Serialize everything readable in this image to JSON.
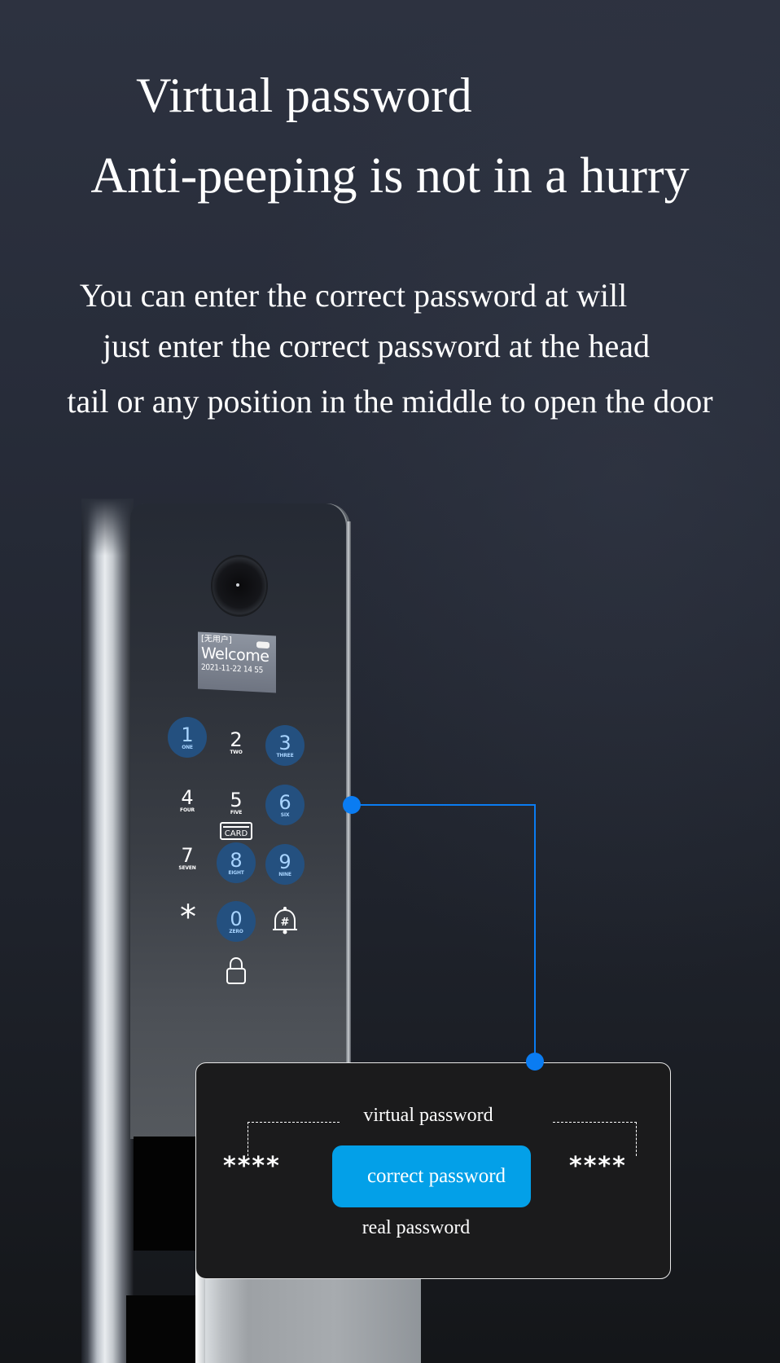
{
  "header": {
    "title": "Virtual password",
    "subtitle": "Anti-peeping is not in a hurry"
  },
  "description": {
    "lines": [
      "You can enter the correct password at will",
      "just enter the correct password at the head",
      "tail or any position in the middle to open the door"
    ]
  },
  "lock": {
    "screen": {
      "user_label": "[无用户]",
      "welcome": "Welcome",
      "datetime": "2021-11-22 14 55",
      "battery_icon": "battery-icon"
    },
    "keypad": [
      {
        "digit": "1",
        "word": "ONE",
        "lit": true
      },
      {
        "digit": "2",
        "word": "TWO",
        "lit": false
      },
      {
        "digit": "3",
        "word": "THREE",
        "lit": true
      },
      {
        "digit": "4",
        "word": "FOUR",
        "lit": false
      },
      {
        "digit": "5",
        "word": "FIVE",
        "lit": false
      },
      {
        "digit": "6",
        "word": "SIX",
        "lit": true
      },
      {
        "digit": "7",
        "word": "SEVEN",
        "lit": false
      },
      {
        "digit": "8",
        "word": "EIGHT",
        "lit": true
      },
      {
        "digit": "9",
        "word": "NINE",
        "lit": true
      },
      {
        "digit": "0",
        "word": "ZERO",
        "lit": true
      }
    ],
    "card_label": "CARD",
    "star_key": "*",
    "bell_key_label": "#",
    "lock_icon": "padlock-icon"
  },
  "callout": {
    "virtual_label": "virtual password",
    "left_mask": "****",
    "right_mask": "****",
    "correct_button": "correct password",
    "real_label": "real password"
  },
  "colors": {
    "accent_blue": "#0a7cf2",
    "button_blue": "#03a0e8",
    "key_blue": "#24507f",
    "callout_bg": "#1b1b1c"
  }
}
